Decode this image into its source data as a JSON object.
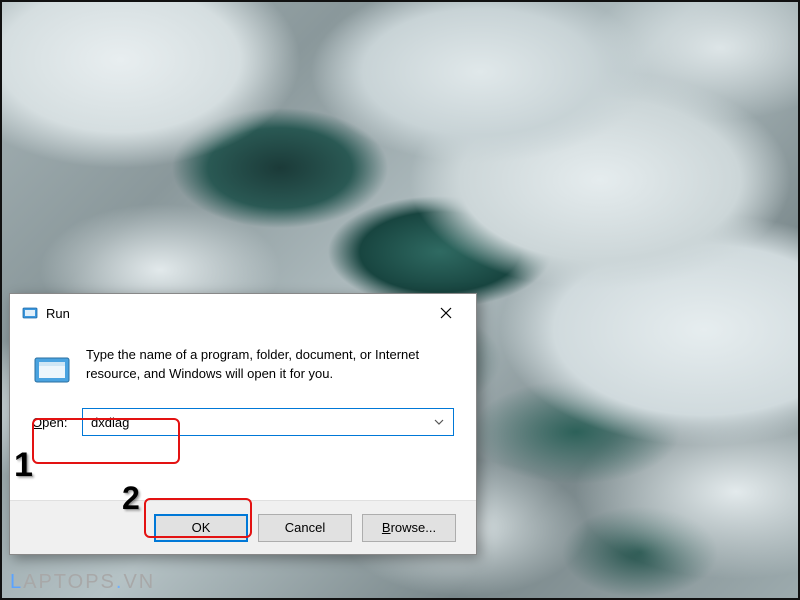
{
  "dialog": {
    "title": "Run",
    "description": "Type the name of a program, folder, document, or Internet resource, and Windows will open it for you.",
    "open_label_prefix": "O",
    "open_label_rest": "pen:",
    "combo_value": "dxdiag",
    "buttons": {
      "ok": "OK",
      "cancel": "Cancel",
      "browse_prefix": "B",
      "browse_rest": "rowse..."
    }
  },
  "annotations": {
    "num1": "1",
    "num2": "2"
  },
  "watermark": {
    "lead": "L",
    "rest": "APTOPS",
    "dot": ".",
    "tld": "VN"
  }
}
